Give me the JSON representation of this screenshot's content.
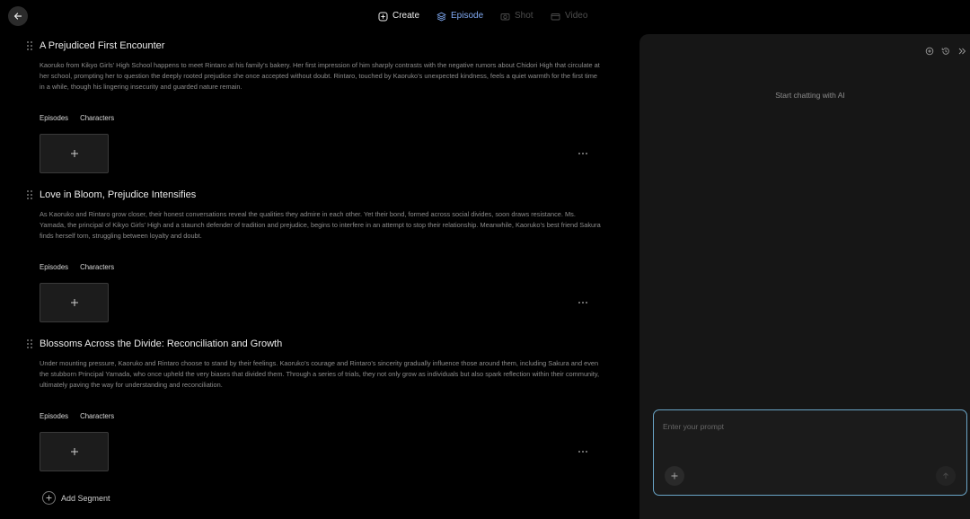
{
  "nav": {
    "back_icon": "arrow-left-icon",
    "tabs": [
      {
        "label": "Create",
        "icon": "plus-circle-icon",
        "state": "normal"
      },
      {
        "label": "Episode",
        "icon": "layers-icon",
        "state": "active"
      },
      {
        "label": "Shot",
        "icon": "camera-icon",
        "state": "disabled"
      },
      {
        "label": "Video",
        "icon": "video-icon",
        "state": "disabled"
      }
    ],
    "active_color": "#7fa8f0"
  },
  "segments": [
    {
      "title": "A Prejudiced First Encounter",
      "description": "Kaoruko from Kikyo Girls’ High School happens to meet Rintaro at his family’s bakery. Her first impression of him sharply contrasts with the negative rumors about Chidori High that circulate at her school, prompting her to question the deeply rooted prejudice she once accepted without doubt. Rintaro, touched by Kaoruko’s unexpected kindness, feels a quiet warmth for the first time in a while, though his lingering insecurity and guarded nature remain.",
      "tabs": [
        "Episodes",
        "Characters"
      ]
    },
    {
      "title": "Love in Bloom, Prejudice Intensifies",
      "description": "As Kaoruko and Rintaro grow closer, their honest conversations reveal the qualities they admire in each other. Yet their bond, formed across social divides, soon draws resistance. Ms. Yamada, the principal of Kikyo Girls’ High and a staunch defender of tradition and prejudice, begins to interfere in an attempt to stop their relationship. Meanwhile, Kaoruko’s best friend Sakura finds herself torn, struggling between loyalty and doubt.",
      "tabs": [
        "Episodes",
        "Characters"
      ]
    },
    {
      "title": "Blossoms Across the Divide: Reconciliation and Growth",
      "description": "Under mounting pressure, Kaoruko and Rintaro choose to stand by their feelings. Kaoruko’s courage and Rintaro’s sincerity gradually influence those around them, including Sakura and even the stubborn Principal Yamada, who once upheld the very biases that divided them. Through a series of trials, they not only grow as individuals but also spark reflection within their community, ultimately paving the way for understanding and reconciliation.",
      "tabs": [
        "Episodes",
        "Characters"
      ]
    }
  ],
  "add_segment_label": "Add Segment",
  "chat": {
    "header_icons": [
      "new-chat-icon",
      "history-icon",
      "collapse-panel-icon"
    ],
    "empty_text": "Start chatting with AI",
    "prompt_placeholder": "Enter your prompt",
    "prompt_value": "",
    "border_color": "#6aa5c7"
  }
}
